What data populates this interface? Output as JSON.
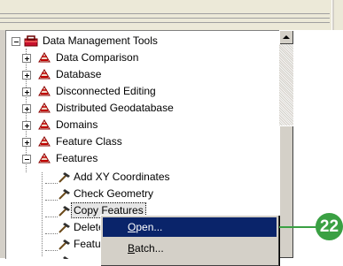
{
  "tree": {
    "root": {
      "label": "Data Management Tools",
      "icon": "toolbox-icon"
    },
    "toolsets": [
      {
        "label": "Data Comparison",
        "state": "collapsed"
      },
      {
        "label": "Database",
        "state": "collapsed"
      },
      {
        "label": "Disconnected Editing",
        "state": "collapsed"
      },
      {
        "label": "Distributed Geodatabase",
        "state": "collapsed"
      },
      {
        "label": "Domains",
        "state": "collapsed"
      },
      {
        "label": "Feature Class",
        "state": "collapsed"
      },
      {
        "label": "Features",
        "state": "expanded"
      }
    ],
    "tools": [
      {
        "label": "Add XY Coordinates"
      },
      {
        "label": "Check Geometry"
      },
      {
        "label": "Copy Features"
      },
      {
        "label": "Delete"
      },
      {
        "label": "Featu"
      }
    ]
  },
  "context_menu": {
    "items": [
      {
        "prefix": "",
        "accel": "O",
        "rest": "pen..."
      },
      {
        "prefix": "",
        "accel": "B",
        "rest": "atch..."
      }
    ]
  },
  "callout": {
    "number": "22",
    "color": "#3aa043"
  },
  "colors": {
    "highlight": "#0a246a",
    "chrome": "#d4d0c8"
  }
}
